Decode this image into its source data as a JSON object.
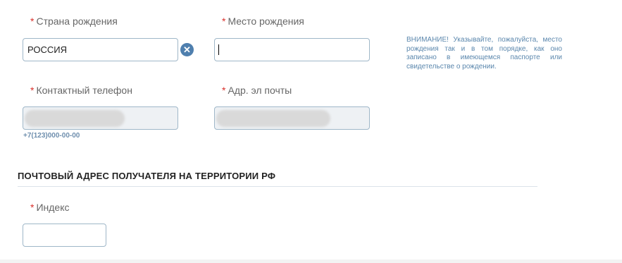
{
  "fields": {
    "birth_country": {
      "label": "Страна рождения",
      "value": "РОССИЯ"
    },
    "birth_place": {
      "label": "Место рождения",
      "value": ""
    },
    "phone": {
      "label": "Контактный телефон",
      "hint": "+7(123)000-00-00"
    },
    "email": {
      "label": "Адр. эл почты"
    },
    "index": {
      "label": "Индекс",
      "value": ""
    }
  },
  "required_mark": "*",
  "clear_icon_glyph": "✕",
  "warning_note": "ВНИМАНИЕ! Указывайте, пожалуйста, место рождения так и в том порядке, как оно записано в имеющемся паспорте или свидетельстве о рождении.",
  "section": {
    "title": "ПОЧТОВЫЙ АДРЕС ПОЛУЧАТЕЛЯ НА ТЕРРИТОРИИ РФ"
  },
  "colors": {
    "required": "#d9302b",
    "accent": "#4f7fae",
    "note": "#5b87ad"
  }
}
